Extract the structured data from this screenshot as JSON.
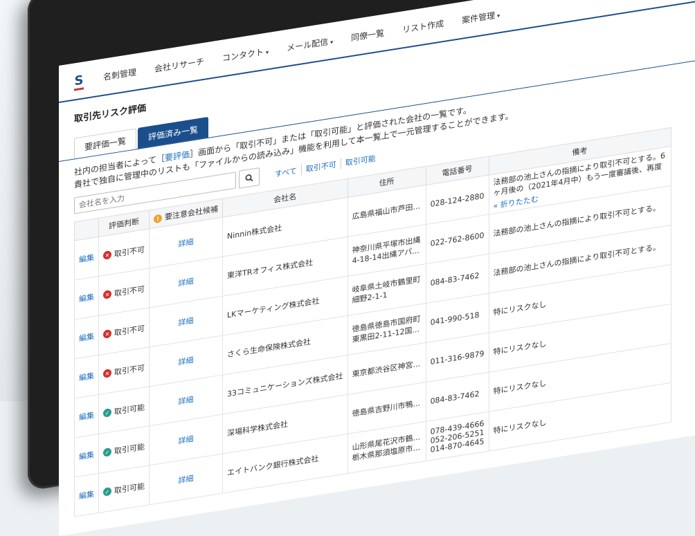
{
  "nav": {
    "items": [
      "名刺管理",
      "会社リサーチ",
      "コンタクト",
      "メール配信",
      "同僚一覧",
      "リスト作成",
      "案件管理"
    ],
    "caret": "▾"
  },
  "page_title": "取引先リスク評価",
  "tabs": [
    "要評価一覧",
    "評価済み一覧"
  ],
  "description": {
    "line1_pre": "社内の担当者によって［",
    "line1_link": "要評価",
    "line1_post": "］画面から「取引不可」または「取引可能」と評価された会社の一覧です。",
    "line2": "貴社で独自に管理中のリストも「ファイルからの読み込み」機能を利用して本一覧上で一元管理することができます。"
  },
  "search": {
    "placeholder": "会社名を入力"
  },
  "filters": [
    "すべて",
    "取引不可",
    "取引可能"
  ],
  "table": {
    "headers": [
      "",
      "評価判断",
      "要注意会社候補",
      "会社名",
      "住所",
      "電話番号",
      "備考"
    ],
    "edit_label": "編集",
    "detail_label": "詳細",
    "rows": [
      {
        "status": "取引不可",
        "company": "Ninnin株式会社",
        "address": "広島県福山市芦田...",
        "phone": "028-124-2880",
        "note": "法務部の池上さんの指摘により取引不可とする。6ヶ月後の（2021年4月中）もう一度審議後、再度",
        "fold": "« 折りたたむ"
      },
      {
        "status": "取引不可",
        "company": "東洋TRオフィス株式会社",
        "address": "神奈川県平塚市出縄4-18-14出縄アパ...",
        "phone": "022-762-8600",
        "note": "法務部の池上さんの指摘により取引不可とする。"
      },
      {
        "status": "取引不可",
        "company": "LKマーケティング株式会社",
        "address": "岐阜県土岐市鶴里町細野2-1-1",
        "phone": "084-83-7462",
        "note": "法務部の池上さんの指摘により取引不可とする。"
      },
      {
        "status": "取引不可",
        "company": "さくら生命保険株式会社",
        "address": "徳島県徳島市国府町東黒田2-11-12国...",
        "phone": "041-990-518",
        "note": "特にリスクなし"
      },
      {
        "status": "取引可能",
        "company": "33コミュニケーションズ株式会社",
        "address": "東京都渋谷区神宮...",
        "phone": "011-316-9879",
        "note": "特にリスクなし"
      },
      {
        "status": "取引可能",
        "company": "深場科学株式会社",
        "address": "徳島県吉野川市鴨...",
        "phone": "084-83-7462",
        "note": "特にリスクなし"
      },
      {
        "status": "取引可能",
        "company": "エイトバンク銀行株式会社",
        "address": "山形県尾花沢市鶴...",
        "phone": "078-439-4666",
        "note": "特にリスクなし"
      }
    ],
    "extra_addresses": [
      "栃木県那須塩原市..."
    ],
    "extra_phones": [
      "052-206-5251",
      "014-870-4645"
    ]
  },
  "colors": {
    "brand": "#1b4f8c",
    "link": "#1b6ec2",
    "ng": "#d0312d",
    "ok": "#2a9d8f"
  }
}
